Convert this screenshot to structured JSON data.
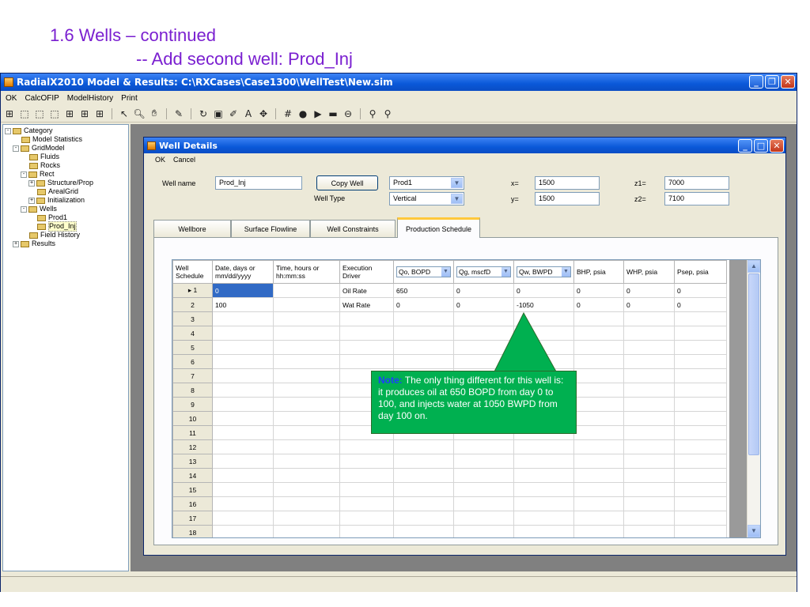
{
  "slide": {
    "title_line1": "1.6 Wells – continued",
    "title_line2": "-- Add second well: Prod_Inj"
  },
  "app": {
    "title": "RadialX2010 Model & Results:  C:\\RXCases\\Case1300\\WellTest\\New.sim",
    "menu": [
      "OK",
      "CalcOFIP",
      "ModelHistory",
      "Print"
    ]
  },
  "tree": [
    {
      "label": "Category",
      "level": 0,
      "exp": "-"
    },
    {
      "label": "Model Statistics",
      "level": 1,
      "exp": ""
    },
    {
      "label": "GridModel",
      "level": 1,
      "exp": "-"
    },
    {
      "label": "Fluids",
      "level": 2,
      "exp": ""
    },
    {
      "label": "Rocks",
      "level": 2,
      "exp": ""
    },
    {
      "label": "Rect",
      "level": 2,
      "exp": "-"
    },
    {
      "label": "Structure/Prop",
      "level": 3,
      "exp": "+"
    },
    {
      "label": "ArealGrid",
      "level": 3,
      "exp": ""
    },
    {
      "label": "Initialization",
      "level": 3,
      "exp": "+"
    },
    {
      "label": "Wells",
      "level": 2,
      "exp": "-"
    },
    {
      "label": "Prod1",
      "level": 3,
      "exp": ""
    },
    {
      "label": "Prod_Inj",
      "level": 3,
      "exp": "",
      "selected": true
    },
    {
      "label": "Field History",
      "level": 2,
      "exp": ""
    },
    {
      "label": "Results",
      "level": 1,
      "exp": "+"
    }
  ],
  "dialog": {
    "title": "Well Details",
    "menu": [
      "OK",
      "Cancel"
    ],
    "well_name_label": "Well name",
    "well_name_value": "Prod_Inj",
    "copy_well_button": "Copy Well",
    "copy_source": "Prod1",
    "well_type_label": "Well Type",
    "well_type_value": "Vertical",
    "x_label": "x=",
    "x_value": "1500",
    "y_label": "y=",
    "y_value": "1500",
    "z1_label": "z1=",
    "z1_value": "7000",
    "z2_label": "z2=",
    "z2_value": "7100",
    "tabs": [
      "Wellbore",
      "Surface Flowline",
      "Well Constraints",
      "Production Schedule"
    ],
    "active_tab": "Production Schedule"
  },
  "grid": {
    "columns": [
      "Well Schedule",
      "Date, days or mm/dd/yyyy",
      "Time, hours or hh:mm:ss",
      "Execution Driver",
      "Qo, BOPD",
      "Qg, mscfD",
      "Qw, BWPD",
      "BHP, psia",
      "WHP, psia",
      "Psep, psia"
    ],
    "rows": [
      [
        "1",
        "0",
        "",
        "Oil Rate",
        "650",
        "0",
        "0",
        "0",
        "0",
        "0"
      ],
      [
        "2",
        "100",
        "",
        "Wat Rate",
        "0",
        "0",
        "-1050",
        "0",
        "0",
        "0"
      ],
      [
        "3",
        "",
        "",
        "",
        "",
        "",
        "",
        "",
        "",
        ""
      ],
      [
        "4",
        "",
        "",
        "",
        "",
        "",
        "",
        "",
        "",
        ""
      ],
      [
        "5",
        "",
        "",
        "",
        "",
        "",
        "",
        "",
        "",
        ""
      ],
      [
        "6",
        "",
        "",
        "",
        "",
        "",
        "",
        "",
        "",
        ""
      ],
      [
        "7",
        "",
        "",
        "",
        "",
        "",
        "",
        "",
        "",
        ""
      ],
      [
        "8",
        "",
        "",
        "",
        "",
        "",
        "",
        "",
        "",
        ""
      ],
      [
        "9",
        "",
        "",
        "",
        "",
        "",
        "",
        "",
        "",
        ""
      ],
      [
        "10",
        "",
        "",
        "",
        "",
        "",
        "",
        "",
        "",
        ""
      ],
      [
        "11",
        "",
        "",
        "",
        "",
        "",
        "",
        "",
        "",
        ""
      ],
      [
        "12",
        "",
        "",
        "",
        "",
        "",
        "",
        "",
        "",
        ""
      ],
      [
        "13",
        "",
        "",
        "",
        "",
        "",
        "",
        "",
        "",
        ""
      ],
      [
        "14",
        "",
        "",
        "",
        "",
        "",
        "",
        "",
        "",
        ""
      ],
      [
        "15",
        "",
        "",
        "",
        "",
        "",
        "",
        "",
        "",
        ""
      ],
      [
        "16",
        "",
        "",
        "",
        "",
        "",
        "",
        "",
        "",
        ""
      ],
      [
        "17",
        "",
        "",
        "",
        "",
        "",
        "",
        "",
        "",
        ""
      ],
      [
        "18",
        "",
        "",
        "",
        "",
        "",
        "",
        "",
        "",
        ""
      ]
    ]
  },
  "note": {
    "prefix": "Note:",
    "text": " The only thing different for this well is: it produces oil at 650 BOPD from day 0 to 100, and injects water at 1050 BWPD from day 100 on."
  },
  "colors": {
    "title_purple": "#7a1fd0",
    "note_green": "#00b050",
    "xp_blue": "#0a58d8"
  }
}
